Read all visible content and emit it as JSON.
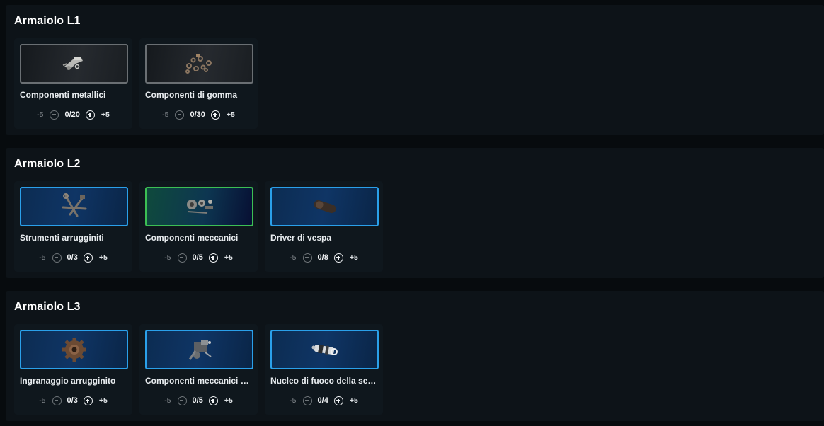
{
  "sections": [
    {
      "title": "Armaiolo L1",
      "items": [
        {
          "name": "Componenti metallici",
          "minus": "-5",
          "qty": "0/20",
          "plus": "+5",
          "frame": "gray",
          "icon": "metal-parts-icon"
        },
        {
          "name": "Componenti di gomma",
          "minus": "-5",
          "qty": "0/30",
          "plus": "+5",
          "frame": "gray",
          "icon": "rubber-parts-icon"
        }
      ]
    },
    {
      "title": "Armaiolo L2",
      "items": [
        {
          "name": "Strumenti arrugginiti",
          "minus": "-5",
          "qty": "0/3",
          "plus": "+5",
          "frame": "blue",
          "icon": "rusty-tools-icon"
        },
        {
          "name": "Componenti meccanici",
          "minus": "-5",
          "qty": "0/5",
          "plus": "+5",
          "frame": "green",
          "icon": "mechanical-parts-icon"
        },
        {
          "name": "Driver di vespa",
          "minus": "-5",
          "qty": "0/8",
          "plus": "+5",
          "frame": "blue",
          "icon": "wasp-driver-icon"
        }
      ]
    },
    {
      "title": "Armaiolo L3",
      "items": [
        {
          "name": "Ingranaggio arrugginito",
          "minus": "-5",
          "qty": "0/3",
          "plus": "+5",
          "frame": "blue",
          "icon": "rusty-gear-icon"
        },
        {
          "name": "Componenti meccanici av...",
          "minus": "-5",
          "qty": "0/5",
          "plus": "+5",
          "frame": "blue",
          "icon": "advanced-mechanical-parts-icon"
        },
        {
          "name": "Nucleo di fuoco della sent...",
          "minus": "-5",
          "qty": "0/4",
          "plus": "+5",
          "frame": "blue",
          "icon": "sentinel-fire-core-icon"
        }
      ]
    }
  ],
  "colors": {
    "background": "#070b0e",
    "panel": "#0d1318",
    "frame_blue": "#2aa0ea",
    "frame_green": "#3cbf54",
    "frame_gray": "#6a6f73"
  }
}
